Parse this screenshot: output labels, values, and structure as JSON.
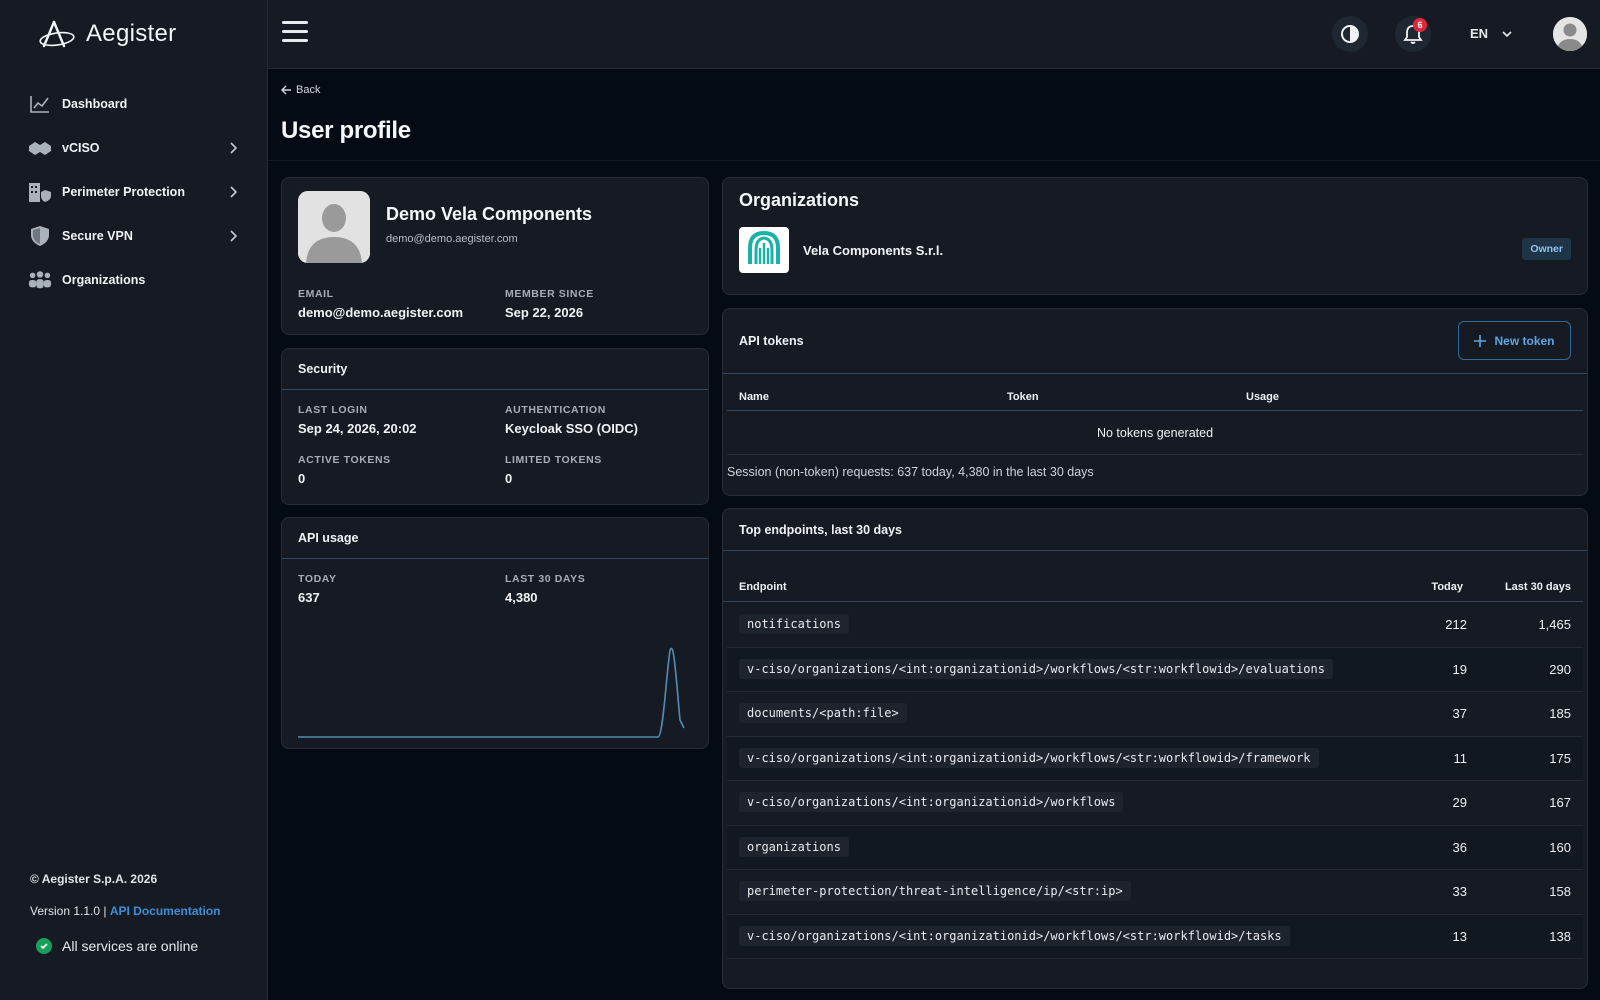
{
  "app": {
    "brand": "Aegister",
    "accent_color": "#3a8fd6"
  },
  "sidebar": {
    "items": [
      {
        "label": "Dashboard",
        "icon": "chart-line-icon",
        "has_submenu": false
      },
      {
        "label": "vCISO",
        "icon": "handshake-icon",
        "has_submenu": true
      },
      {
        "label": "Perimeter Protection",
        "icon": "building-shield-icon",
        "has_submenu": true
      },
      {
        "label": "Secure VPN",
        "icon": "shield-icon",
        "has_submenu": true
      },
      {
        "label": "Organizations",
        "icon": "users-icon",
        "has_submenu": false
      }
    ],
    "footer": {
      "copyright": "© Aegister S.p.A. 2026",
      "version_prefix": "Version 1.1.0 |",
      "api_docs_link": "API Documentation",
      "status": "All services are online"
    }
  },
  "header": {
    "theme_toggle_icon": "contrast-icon",
    "notifications_count": "6",
    "language": "EN"
  },
  "page": {
    "back_label": "Back",
    "title": "User profile"
  },
  "profile": {
    "name": "Demo Vela Components",
    "email_small": "demo@demo.aegister.com",
    "email_label": "EMAIL",
    "email_value": "demo@demo.aegister.com",
    "member_since_label": "MEMBER SINCE",
    "member_since_value": "Sep 22, 2026"
  },
  "security": {
    "title": "Security",
    "last_login_label": "LAST LOGIN",
    "last_login_value": "Sep 24, 2026, 20:02",
    "auth_label": "AUTHENTICATION",
    "auth_value": "Keycloak SSO (OIDC)",
    "active_tokens_label": "ACTIVE TOKENS",
    "active_tokens_value": "0",
    "limited_tokens_label": "LIMITED TOKENS",
    "limited_tokens_value": "0"
  },
  "api_usage": {
    "title": "API usage",
    "today_label": "TODAY",
    "today_value": "637",
    "last30_label": "LAST 30 DAYS",
    "last30_value": "4,380"
  },
  "organizations": {
    "title": "Organizations",
    "items": [
      {
        "name": "Vela Components S.r.l.",
        "role": "Owner"
      }
    ]
  },
  "api_tokens": {
    "title": "API tokens",
    "new_token_label": "New token",
    "columns": [
      "Name",
      "Token",
      "Usage"
    ],
    "empty_message": "No tokens generated",
    "session_note": "Session (non-token) requests: 637 today, 4,380 in the last 30 days"
  },
  "top_endpoints": {
    "title": "Top endpoints, last 30 days",
    "columns": {
      "endpoint": "Endpoint",
      "today": "Today",
      "last30": "Last 30 days"
    },
    "rows": [
      {
        "endpoint": "notifications",
        "today": "212",
        "last30": "1,465"
      },
      {
        "endpoint": "v-ciso/organizations/<int:organizationid>/workflows/<str:workflowid>/evaluations",
        "today": "19",
        "last30": "290"
      },
      {
        "endpoint": "documents/<path:file>",
        "today": "37",
        "last30": "185"
      },
      {
        "endpoint": "v-ciso/organizations/<int:organizationid>/workflows/<str:workflowid>/framework",
        "today": "11",
        "last30": "175"
      },
      {
        "endpoint": "v-ciso/organizations/<int:organizationid>/workflows",
        "today": "29",
        "last30": "167"
      },
      {
        "endpoint": "organizations",
        "today": "36",
        "last30": "160"
      },
      {
        "endpoint": "perimeter-protection/threat-intelligence/ip/<str:ip>",
        "today": "33",
        "last30": "158"
      },
      {
        "endpoint": "v-ciso/organizations/<int:organizationid>/workflows/<str:workflowid>/tasks",
        "today": "13",
        "last30": "138"
      }
    ]
  }
}
